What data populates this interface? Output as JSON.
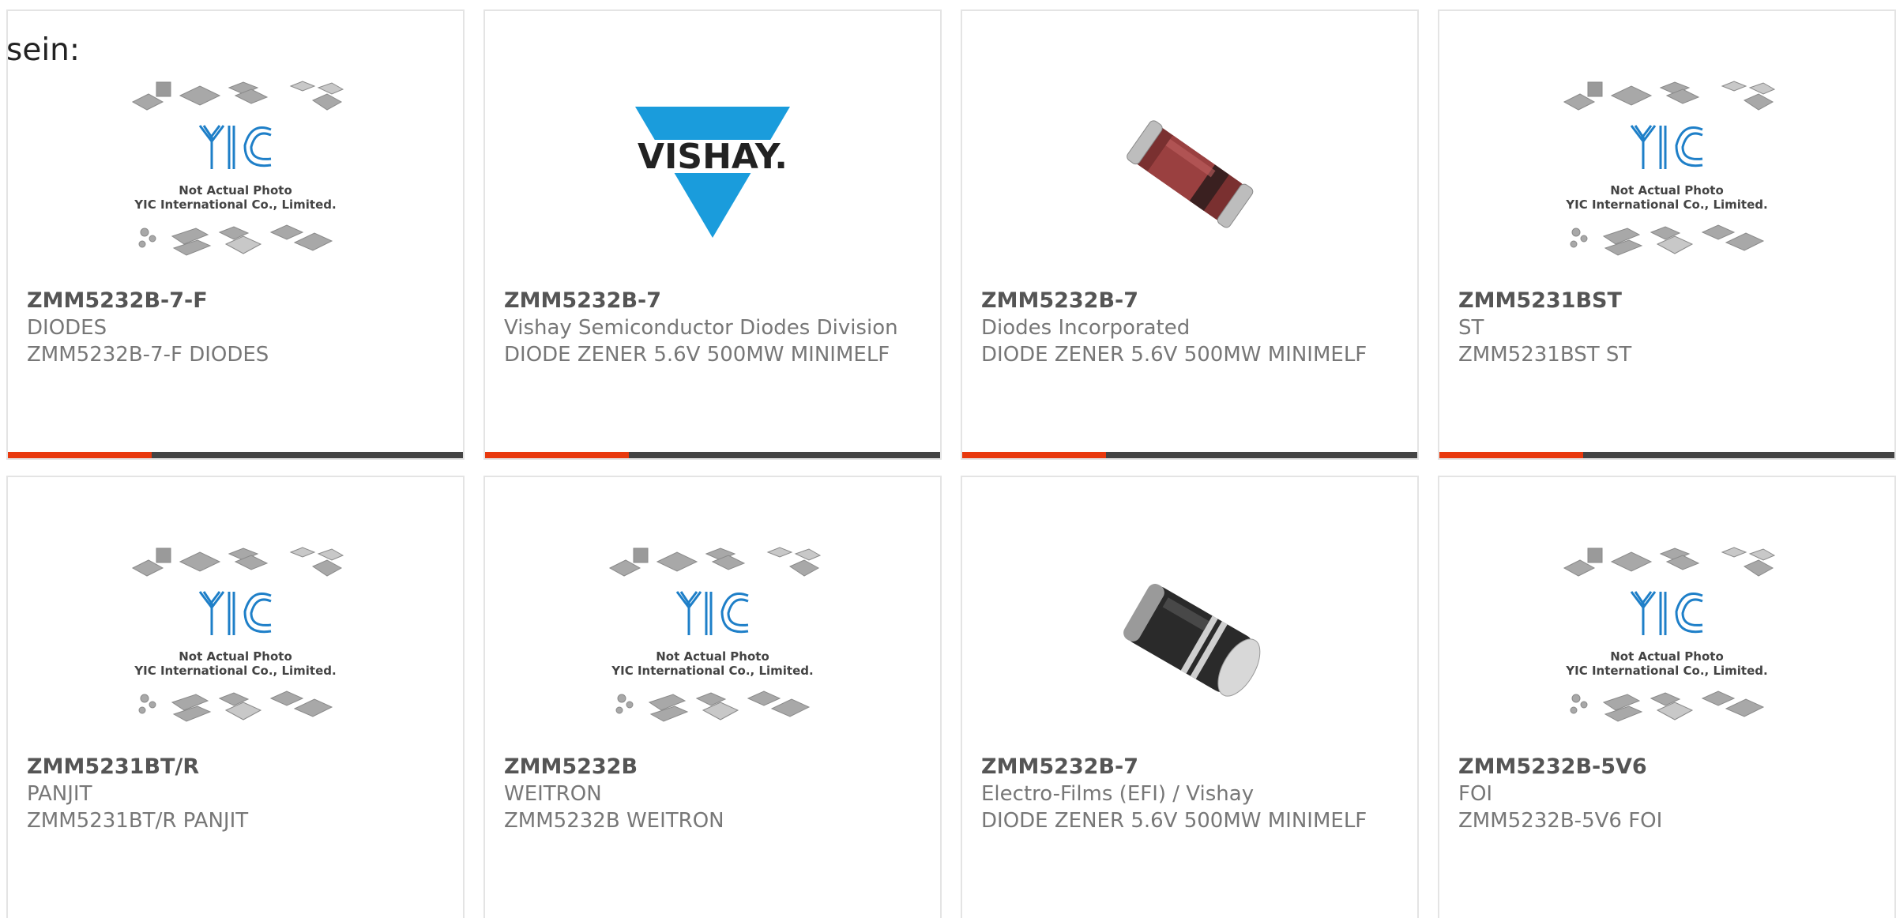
{
  "intro_text": "sein:",
  "yic_image": {
    "line1": "Not Actual Photo",
    "line2": "YIC International Co., Limited.",
    "logo": "YIC"
  },
  "vishay_logo": "VISHAY.",
  "colors": {
    "accent": "#e8390e",
    "bar": "#444444",
    "yic_blue": "#1e7fc8",
    "vishay_blue": "#1a9cdc"
  },
  "products": [
    {
      "part": "ZMM5232B-7-F",
      "maker": "DIODES",
      "desc": "ZMM5232B-7-F DIODES",
      "image": "yic-placeholder"
    },
    {
      "part": "ZMM5232B-7",
      "maker": "Vishay Semiconductor Diodes Division",
      "desc": "DIODE ZENER 5.6V 500MW MINIMELF",
      "image": "vishay-logo"
    },
    {
      "part": "ZMM5232B-7",
      "maker": "Diodes Incorporated",
      "desc": "DIODE ZENER 5.6V 500MW MINIMELF",
      "image": "red-minimelf"
    },
    {
      "part": "ZMM5231BST",
      "maker": "ST",
      "desc": "ZMM5231BST ST",
      "image": "yic-placeholder"
    },
    {
      "part": "ZMM5231BT/R",
      "maker": "PANJIT",
      "desc": "ZMM5231BT/R PANJIT",
      "image": "yic-placeholder"
    },
    {
      "part": "ZMM5232B",
      "maker": "WEITRON",
      "desc": "ZMM5232B WEITRON",
      "image": "yic-placeholder"
    },
    {
      "part": "ZMM5232B-7",
      "maker": "Electro-Films (EFI) / Vishay",
      "desc": "DIODE ZENER 5.6V 500MW MINIMELF",
      "image": "black-minimelf"
    },
    {
      "part": "ZMM5232B-5V6",
      "maker": "FOI",
      "desc": "ZMM5232B-5V6 FOI",
      "image": "yic-placeholder"
    }
  ]
}
